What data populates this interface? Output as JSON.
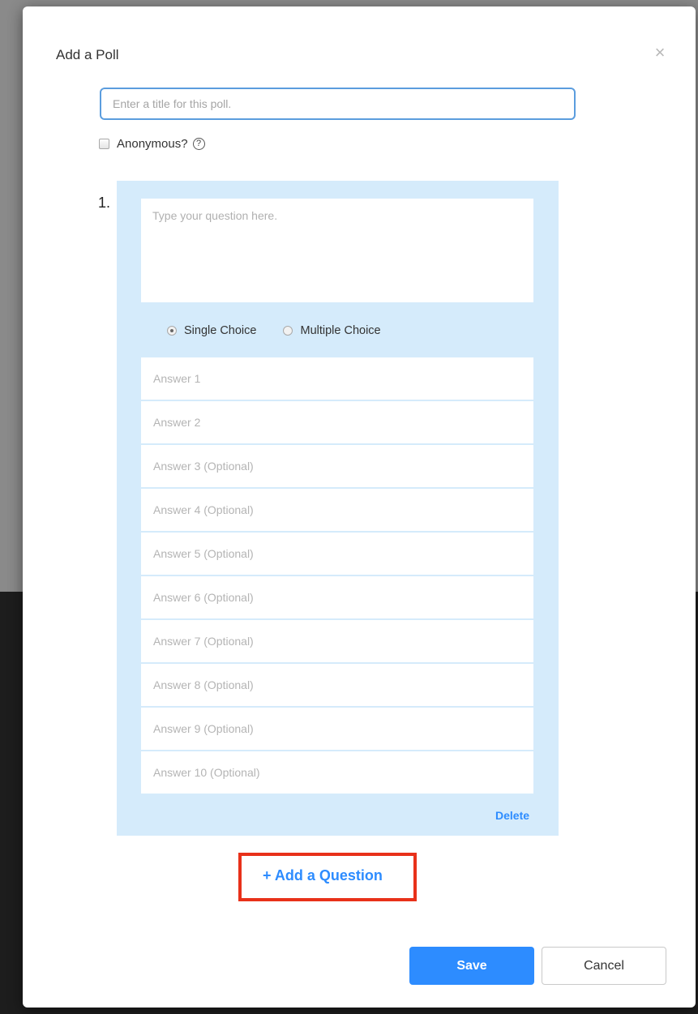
{
  "dialog": {
    "title": "Add a Poll",
    "close_glyph": "×"
  },
  "poll": {
    "title_placeholder": "Enter a title for this poll.",
    "anonymous_label": "Anonymous?",
    "help_glyph": "?"
  },
  "question": {
    "number": "1.",
    "text_placeholder": "Type your question here.",
    "choice_types": [
      {
        "label": "Single Choice",
        "selected": true
      },
      {
        "label": "Multiple Choice",
        "selected": false
      }
    ],
    "answers": [
      "Answer 1",
      "Answer 2",
      "Answer 3 (Optional)",
      "Answer 4 (Optional)",
      "Answer 5 (Optional)",
      "Answer 6 (Optional)",
      "Answer 7 (Optional)",
      "Answer 8 (Optional)",
      "Answer 9 (Optional)",
      "Answer 10 (Optional)"
    ],
    "delete_label": "Delete"
  },
  "actions": {
    "add_question_label": "+ Add a Question",
    "save_label": "Save",
    "cancel_label": "Cancel"
  },
  "colors": {
    "accent": "#2d8cff",
    "highlight_box": "#e8311a",
    "question_panel": "#d5ebfb"
  },
  "icons": {
    "close": "close-icon",
    "help": "help-circle-icon",
    "checkbox": "checkbox-icon",
    "radio": "radio-icon"
  }
}
